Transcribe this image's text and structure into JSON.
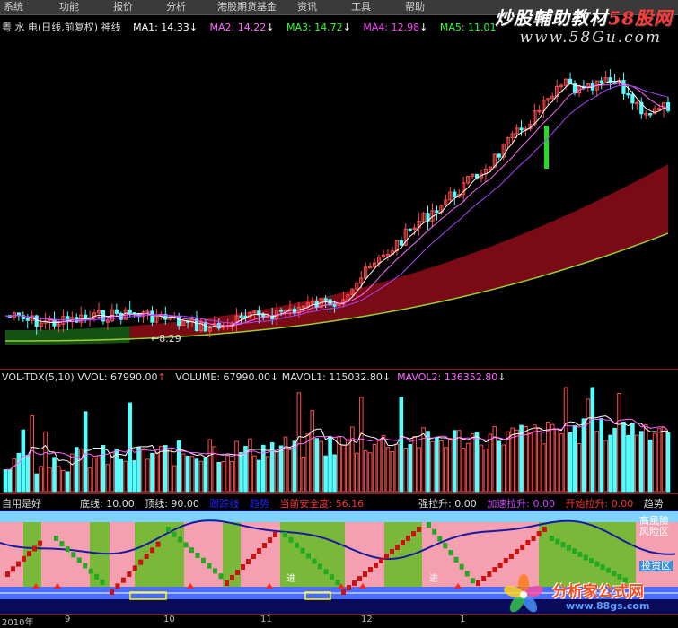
{
  "menu": {
    "items": [
      "系统",
      "功能",
      "报价",
      "分析",
      "港股期货基金",
      "资讯",
      "工具",
      "帮助"
    ]
  },
  "watermark_top": {
    "line1_white": "炒股輔助教材",
    "line1_red": "58股网",
    "line2": "www.58Gu.com"
  },
  "main_chart": {
    "stock_name": "粤 水 电",
    "period": "(日线,前复权)",
    "indicator": "神线",
    "ma": [
      {
        "label": "MA1: 14.33",
        "color": "#ffffff"
      },
      {
        "label": "MA2: 14.22",
        "color": "#ff66ff"
      },
      {
        "label": "MA3: 14.72",
        "color": "#33ff33"
      },
      {
        "label": "MA4: 12.98",
        "color": "#ff44ff"
      },
      {
        "label": "MA5: 11.01",
        "color": "#33ff33"
      }
    ],
    "low_label": "←8.29",
    "colors": {
      "up": "#ff4d4d",
      "down": "#55ffff",
      "green_bar": "#22dd22",
      "band_red": "#7a0a14",
      "band_green": "#145214"
    }
  },
  "volume_panel": {
    "name": "VOL-TDX(5,10)",
    "vvol": "VVOL: 67990.00",
    "volume": "VOLUME: 67990.00",
    "mavol1": "MAVOL1: 115032.80",
    "mavol2": "MAVOL2: 136352.80"
  },
  "indicator_panel": {
    "name": "自用是好",
    "items": [
      {
        "label": "底线: 10.00",
        "color": "#dddddd"
      },
      {
        "label": "顶线: 90.00",
        "color": "#dddddd"
      },
      {
        "label": "跟踪线",
        "color": "#2222ff"
      },
      {
        "label": "趋势",
        "color": "#2222ff"
      },
      {
        "label": "当前安全度: 56.16",
        "color": "#ff3333"
      },
      {
        "label": "强拉升: 0.00",
        "color": "#dddddd"
      },
      {
        "label": "加速拉升: 0.00",
        "color": "#cc44ff"
      },
      {
        "label": "开始拉升: 0.00",
        "color": "#ff3333"
      },
      {
        "label": "趋势",
        "color": "#dddddd"
      }
    ],
    "zone_high": "高風險\n风险区",
    "zone_buy": "投资区",
    "signal": "进"
  },
  "xaxis": {
    "ticks": [
      "2010年",
      "9",
      "10",
      "11",
      "12",
      "1"
    ]
  },
  "logo_bottom": {
    "text": "分析家公式网",
    "url": "www.88gs.com"
  }
}
